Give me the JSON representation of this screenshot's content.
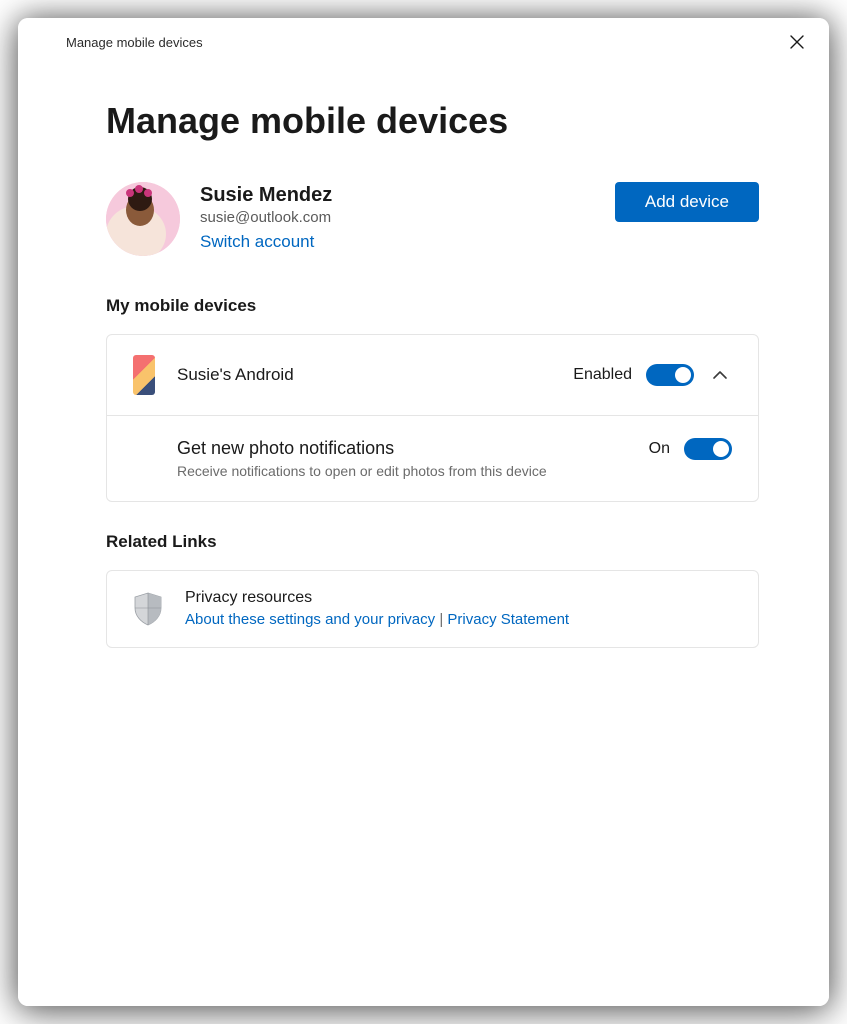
{
  "window": {
    "title": "Manage mobile devices"
  },
  "page": {
    "heading": "Manage mobile devices"
  },
  "account": {
    "name": "Susie Mendez",
    "email": "susie@outlook.com",
    "switch_label": "Switch account",
    "add_device_label": "Add device"
  },
  "devices_section": {
    "heading": "My mobile devices",
    "device": {
      "name": "Susie's Android",
      "status_label": "Enabled",
      "setting": {
        "title": "Get new photo notifications",
        "description": "Receive notifications to open or edit photos from this device",
        "status_label": "On"
      }
    }
  },
  "related_section": {
    "heading": "Related Links",
    "privacy": {
      "title": "Privacy resources",
      "link_about": "About these settings and your privacy",
      "separator": " | ",
      "link_statement": "Privacy Statement"
    }
  }
}
